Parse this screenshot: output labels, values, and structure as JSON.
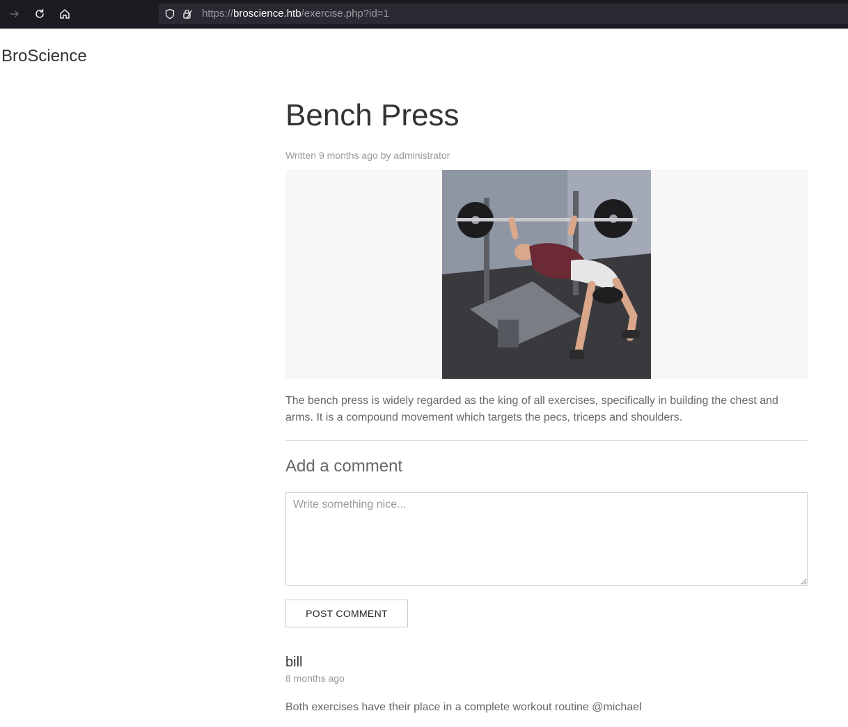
{
  "browser": {
    "url_scheme": "https://",
    "url_host": "broscience.htb",
    "url_path": "/exercise.php?id=1"
  },
  "site": {
    "brand": "BroScience"
  },
  "post": {
    "title": "Bench Press",
    "meta": "Written 9 months ago by administrator",
    "description": "The bench press is widely regarded as the king of all exercises, specifically in building the chest and arms. It is a compound movement which targets the pecs, triceps and shoulders."
  },
  "comment_form": {
    "heading": "Add a comment",
    "placeholder": "Write something nice...",
    "submit_label": "POST COMMENT"
  },
  "comments": [
    {
      "author": "bill",
      "time": "8 months ago",
      "body": "Both exercises have their place in a complete workout routine @michael"
    }
  ]
}
